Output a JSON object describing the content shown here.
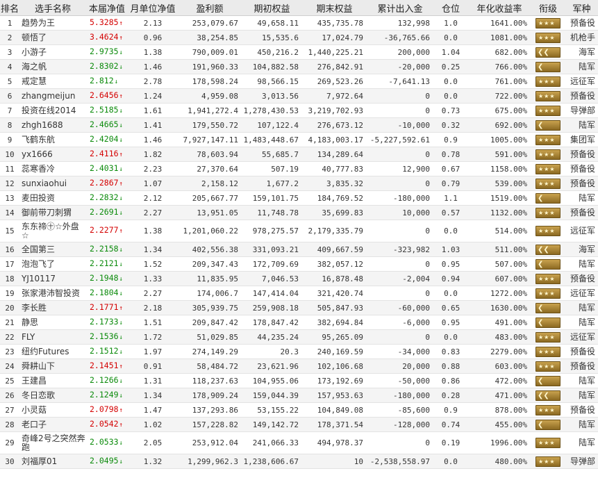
{
  "headers": [
    "排名",
    "选手名称",
    "本届净值",
    "月单位净值",
    "盈利额",
    "期初权益",
    "期末权益",
    "累计出入金",
    "仓位",
    "年化收益率",
    "衔级",
    "军种"
  ],
  "rows": [
    {
      "rank": "1",
      "name": "趋势为王",
      "nav": "5.3285",
      "dir": "up",
      "arrow": "↑",
      "monthly": "2.13",
      "profit": "253,079.67",
      "begin": "49,658.11",
      "end": "435,735.78",
      "flow": "132,998",
      "position": "1.0",
      "annual": "1641.00%",
      "insignia": "stars3",
      "army": "预备役"
    },
    {
      "rank": "2",
      "name": "顿悟了",
      "nav": "3.4624",
      "dir": "up",
      "arrow": "↑",
      "monthly": "0.96",
      "profit": "38,254.85",
      "begin": "15,535.6",
      "end": "17,024.79",
      "flow": "-36,765.66",
      "position": "0.0",
      "annual": "1081.00%",
      "insignia": "stars3",
      "army": "机枪手"
    },
    {
      "rank": "3",
      "name": "小游子",
      "nav": "2.9735",
      "dir": "down",
      "arrow": "↓",
      "monthly": "1.38",
      "profit": "790,009.01",
      "begin": "450,216.2",
      "end": "1,440,225.21",
      "flow": "200,000",
      "position": "1.04",
      "annual": "682.00%",
      "insignia": "chevron2",
      "army": "海军"
    },
    {
      "rank": "4",
      "name": "海之帆",
      "nav": "2.8302",
      "dir": "down",
      "arrow": "↓",
      "monthly": "1.46",
      "profit": "191,960.33",
      "begin": "104,882.58",
      "end": "276,842.91",
      "flow": "-20,000",
      "position": "0.25",
      "annual": "766.00%",
      "insignia": "chevron1",
      "army": "陆军"
    },
    {
      "rank": "5",
      "name": "戒定慧",
      "nav": "2.812",
      "dir": "down",
      "arrow": "↓",
      "monthly": "2.78",
      "profit": "178,598.24",
      "begin": "98,566.15",
      "end": "269,523.26",
      "flow": "-7,641.13",
      "position": "0.0",
      "annual": "761.00%",
      "insignia": "stars3",
      "army": "远征军"
    },
    {
      "rank": "6",
      "name": "zhangmeijun",
      "nav": "2.6456",
      "dir": "up",
      "arrow": "↑",
      "monthly": "1.24",
      "profit": "4,959.08",
      "begin": "3,013.56",
      "end": "7,972.64",
      "flow": "0",
      "position": "0.0",
      "annual": "722.00%",
      "insignia": "stars3",
      "army": "预备役"
    },
    {
      "rank": "7",
      "name": "投资在线2014",
      "nav": "2.5185",
      "dir": "down",
      "arrow": "↓",
      "monthly": "1.61",
      "profit": "1,941,272.4",
      "begin": "1,278,430.53",
      "end": "3,219,702.93",
      "flow": "0",
      "position": "0.73",
      "annual": "675.00%",
      "insignia": "stars3",
      "army": "导弹部"
    },
    {
      "rank": "8",
      "name": "zhgh1688",
      "nav": "2.4665",
      "dir": "down",
      "arrow": "↓",
      "monthly": "1.41",
      "profit": "179,550.72",
      "begin": "107,122.4",
      "end": "276,673.12",
      "flow": "-10,000",
      "position": "0.32",
      "annual": "692.00%",
      "insignia": "chevron1",
      "army": "陆军"
    },
    {
      "rank": "9",
      "name": "飞鹤东航",
      "nav": "2.4204",
      "dir": "down",
      "arrow": "↓",
      "monthly": "1.46",
      "profit": "7,927,147.11",
      "begin": "1,483,448.67",
      "end": "4,183,003.17",
      "flow": "-5,227,592.61",
      "position": "0.9",
      "annual": "1005.00%",
      "insignia": "stars3",
      "army": "集团军"
    },
    {
      "rank": "10",
      "name": "yx1666",
      "nav": "2.4116",
      "dir": "up",
      "arrow": "↑",
      "monthly": "1.82",
      "profit": "78,603.94",
      "begin": "55,685.7",
      "end": "134,289.64",
      "flow": "0",
      "position": "0.78",
      "annual": "591.00%",
      "insignia": "stars3",
      "army": "预备役"
    },
    {
      "rank": "11",
      "name": "蕊寒香冷",
      "nav": "2.4031",
      "dir": "down",
      "arrow": "↓",
      "monthly": "2.23",
      "profit": "27,370.64",
      "begin": "507.19",
      "end": "40,777.83",
      "flow": "12,900",
      "position": "0.67",
      "annual": "1158.00%",
      "insignia": "stars3",
      "army": "预备役"
    },
    {
      "rank": "12",
      "name": "sunxiaohui",
      "nav": "2.2867",
      "dir": "up",
      "arrow": "↑",
      "monthly": "1.07",
      "profit": "2,158.12",
      "begin": "1,677.2",
      "end": "3,835.32",
      "flow": "0",
      "position": "0.79",
      "annual": "539.00%",
      "insignia": "stars3",
      "army": "预备役"
    },
    {
      "rank": "13",
      "name": "麦田投资",
      "nav": "2.2832",
      "dir": "down",
      "arrow": "↓",
      "monthly": "2.12",
      "profit": "205,667.77",
      "begin": "159,101.75",
      "end": "184,769.52",
      "flow": "-180,000",
      "position": "1.1",
      "annual": "1519.00%",
      "insignia": "chevron1",
      "army": "陆军"
    },
    {
      "rank": "14",
      "name": "御前带刀刺猬",
      "nav": "2.2691",
      "dir": "down",
      "arrow": "↓",
      "monthly": "2.27",
      "profit": "13,951.05",
      "begin": "11,748.78",
      "end": "35,699.83",
      "flow": "10,000",
      "position": "0.57",
      "annual": "1132.00%",
      "insignia": "stars3",
      "army": "预备役"
    },
    {
      "rank": "15",
      "name": "东东禘㊉☆外盘☆",
      "nav": "2.2277",
      "dir": "up",
      "arrow": "↑",
      "monthly": "1.38",
      "profit": "1,201,060.22",
      "begin": "978,275.57",
      "end": "2,179,335.79",
      "flow": "0",
      "position": "0.0",
      "annual": "514.00%",
      "insignia": "stars3",
      "army": "远征军",
      "tall": true
    },
    {
      "rank": "16",
      "name": "全国第三",
      "nav": "2.2158",
      "dir": "down",
      "arrow": "↓",
      "monthly": "1.34",
      "profit": "402,556.38",
      "begin": "331,093.21",
      "end": "409,667.59",
      "flow": "-323,982",
      "position": "1.03",
      "annual": "511.00%",
      "insignia": "chevron2",
      "army": "海军"
    },
    {
      "rank": "17",
      "name": "泡泡飞了",
      "nav": "2.2121",
      "dir": "down",
      "arrow": "↓",
      "monthly": "1.52",
      "profit": "209,347.43",
      "begin": "172,709.69",
      "end": "382,057.12",
      "flow": "0",
      "position": "0.95",
      "annual": "507.00%",
      "insignia": "chevron1",
      "army": "陆军"
    },
    {
      "rank": "18",
      "name": "YJ10117",
      "nav": "2.1948",
      "dir": "down",
      "arrow": "↓",
      "monthly": "1.33",
      "profit": "11,835.95",
      "begin": "7,046.53",
      "end": "16,878.48",
      "flow": "-2,004",
      "position": "0.94",
      "annual": "607.00%",
      "insignia": "stars3",
      "army": "预备役"
    },
    {
      "rank": "19",
      "name": "张家港沛智投资",
      "nav": "2.1804",
      "dir": "down",
      "arrow": "↓",
      "monthly": "2.27",
      "profit": "174,006.7",
      "begin": "147,414.04",
      "end": "321,420.74",
      "flow": "0",
      "position": "0.0",
      "annual": "1272.00%",
      "insignia": "stars3",
      "army": "远征军"
    },
    {
      "rank": "20",
      "name": "李长胜",
      "nav": "2.1771",
      "dir": "up",
      "arrow": "↑",
      "monthly": "2.18",
      "profit": "305,939.75",
      "begin": "259,908.18",
      "end": "505,847.93",
      "flow": "-60,000",
      "position": "0.65",
      "annual": "1630.00%",
      "insignia": "chevron1",
      "army": "陆军"
    },
    {
      "rank": "21",
      "name": "静思",
      "nav": "2.1733",
      "dir": "down",
      "arrow": "↓",
      "monthly": "1.51",
      "profit": "209,847.42",
      "begin": "178,847.42",
      "end": "382,694.84",
      "flow": "-6,000",
      "position": "0.95",
      "annual": "491.00%",
      "insignia": "chevron1",
      "army": "陆军"
    },
    {
      "rank": "22",
      "name": "FLY",
      "nav": "2.1536",
      "dir": "down",
      "arrow": "↓",
      "monthly": "1.72",
      "profit": "51,029.85",
      "begin": "44,235.24",
      "end": "95,265.09",
      "flow": "0",
      "position": "0.0",
      "annual": "483.00%",
      "insignia": "stars3",
      "army": "远征军"
    },
    {
      "rank": "23",
      "name": "纽约Futures",
      "nav": "2.1512",
      "dir": "down",
      "arrow": "↓",
      "monthly": "1.97",
      "profit": "274,149.29",
      "begin": "20.3",
      "end": "240,169.59",
      "flow": "-34,000",
      "position": "0.83",
      "annual": "2279.00%",
      "insignia": "stars3",
      "army": "预备役"
    },
    {
      "rank": "24",
      "name": "舜耕山下",
      "nav": "2.1451",
      "dir": "up",
      "arrow": "↑",
      "monthly": "0.91",
      "profit": "58,484.72",
      "begin": "23,621.96",
      "end": "102,106.68",
      "flow": "20,000",
      "position": "0.88",
      "annual": "603.00%",
      "insignia": "stars3",
      "army": "预备役"
    },
    {
      "rank": "25",
      "name": "王建昌",
      "nav": "2.1266",
      "dir": "down",
      "arrow": "↓",
      "monthly": "1.31",
      "profit": "118,237.63",
      "begin": "104,955.06",
      "end": "173,192.69",
      "flow": "-50,000",
      "position": "0.86",
      "annual": "472.00%",
      "insignia": "chevron1",
      "army": "陆军"
    },
    {
      "rank": "26",
      "name": "冬日恋歌",
      "nav": "2.1249",
      "dir": "down",
      "arrow": "↓",
      "monthly": "1.34",
      "profit": "178,909.24",
      "begin": "159,044.39",
      "end": "157,953.63",
      "flow": "-180,000",
      "position": "0.28",
      "annual": "471.00%",
      "insignia": "chevron2",
      "army": "陆军"
    },
    {
      "rank": "27",
      "name": "小灵菇",
      "nav": "2.0798",
      "dir": "up",
      "arrow": "↑",
      "monthly": "1.47",
      "profit": "137,293.86",
      "begin": "53,155.22",
      "end": "104,849.08",
      "flow": "-85,600",
      "position": "0.9",
      "annual": "878.00%",
      "insignia": "stars3",
      "army": "预备役"
    },
    {
      "rank": "28",
      "name": "老口子",
      "nav": "2.0542",
      "dir": "up",
      "arrow": "↑",
      "monthly": "1.02",
      "profit": "157,228.82",
      "begin": "149,142.72",
      "end": "178,371.54",
      "flow": "-128,000",
      "position": "0.74",
      "annual": "455.00%",
      "insignia": "chevron1",
      "army": "陆军"
    },
    {
      "rank": "29",
      "name": "奇峰2号之突然奔跑",
      "nav": "2.0533",
      "dir": "down",
      "arrow": "↓",
      "monthly": "2.05",
      "profit": "253,912.04",
      "begin": "241,066.33",
      "end": "494,978.37",
      "flow": "0",
      "position": "0.19",
      "annual": "1996.00%",
      "insignia": "stars3",
      "army": "陆军",
      "tall": true
    },
    {
      "rank": "30",
      "name": "刘福厚01",
      "nav": "2.0495",
      "dir": "down",
      "arrow": "↓",
      "monthly": "1.32",
      "profit": "1,299,962.3",
      "begin": "1,238,606.67",
      "end": "10",
      "flow": "-2,538,558.97",
      "position": "0.0",
      "annual": "480.00%",
      "insignia": "stars3",
      "army": "导弹部"
    }
  ]
}
